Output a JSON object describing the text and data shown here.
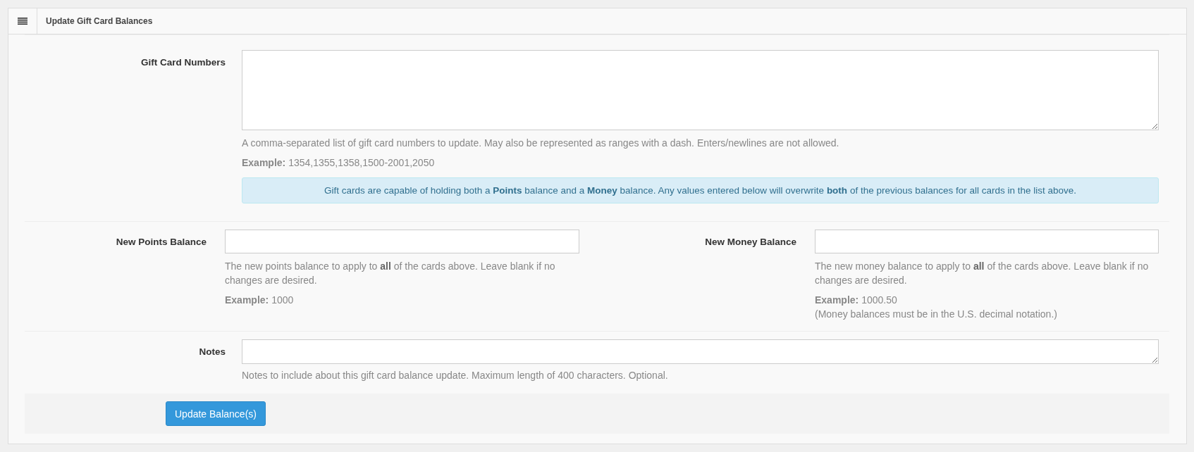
{
  "panel": {
    "title": "Update Gift Card Balances"
  },
  "gift_card_numbers": {
    "label": "Gift Card Numbers",
    "kind": "textarea",
    "help": "A comma-separated list of gift card numbers to update. May also be represented as ranges with a dash. Enters/newlines are not allowed.",
    "example": "**Example:** 1354,1355,1358,1500-2001,2050",
    "alert": "Gift cards are capable of holding both a **Points** balance and a **Money** balance. Any values entered below will overwrite **both** of the previous balances for all cards in the list above."
  },
  "balances": [
    {
      "label": "New Points Balance",
      "kind": "input",
      "help": "The new points balance to apply to **all** of the cards above. Leave blank if no changes are desired.",
      "example": "**Example:** 1000"
    },
    {
      "label": "New Money Balance",
      "kind": "input",
      "help": "The new money balance to apply to **all** of the cards above. Leave blank if no changes are desired.",
      "example": "**Example:** 1000.50",
      "note": "(Money balances must be in the U.S. decimal notation.)"
    }
  ],
  "notes": {
    "label": "Notes",
    "kind": "textarea",
    "help": "Notes to include about this gift card balance update. Maximum length of 400 characters. Optional."
  },
  "submit": {
    "label": "Update Balance(s)"
  }
}
